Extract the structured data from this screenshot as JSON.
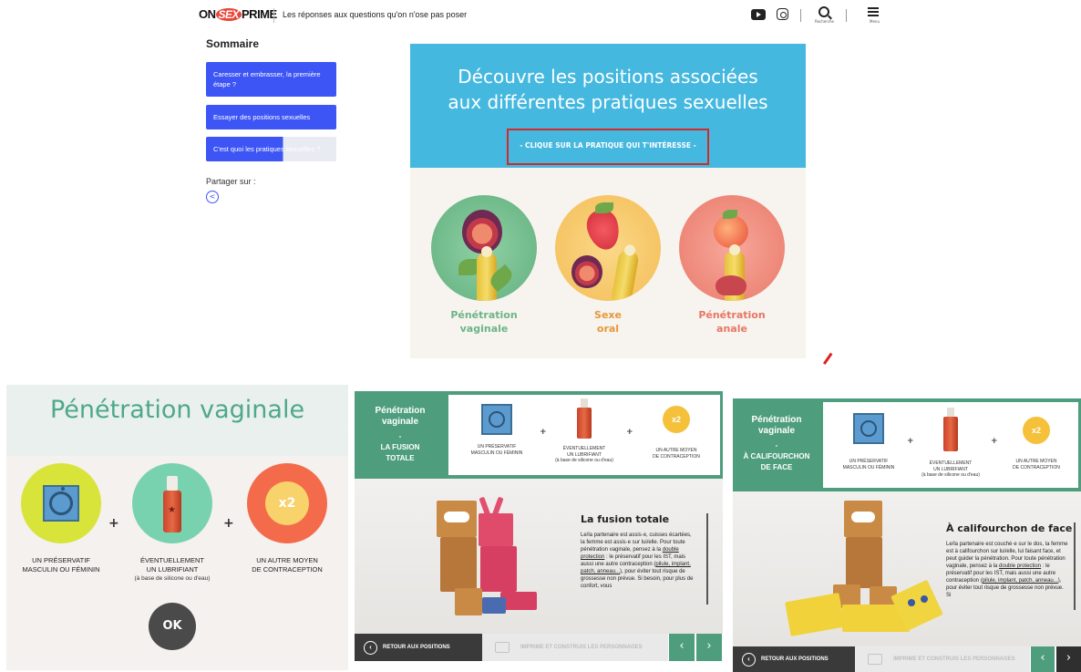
{
  "header": {
    "logo_left": "ON",
    "logo_mid": "SEX",
    "logo_right": "PRIME",
    "tagline": "Les réponses aux questions qu'on n'ose pas poser",
    "search_label": "Recherche",
    "menu_label": "Menu",
    "icons": [
      "youtube-icon",
      "instagram-icon",
      "search-icon",
      "menu-icon"
    ]
  },
  "sidebar": {
    "title": "Sommaire",
    "items": [
      {
        "label": "Caresser et embrasser, la première étape ?"
      },
      {
        "label": "Essayer des positions sexuelles"
      },
      {
        "label": "C'est quoi les pratiques sexuelles ?"
      }
    ],
    "share_label": "Partager sur :"
  },
  "hero": {
    "title_line1": "Découvre les positions associées",
    "title_line2": "aux différentes pratiques sexuelles",
    "cta": "- CLIQUE SUR LA PRATIQUE QUI T'INTÉRESSE -"
  },
  "choices": [
    {
      "line1": "Pénétration",
      "line2": "vaginale",
      "color": "#7cbf8f"
    },
    {
      "line1": "Sexe",
      "line2": "oral",
      "color": "#e8973a"
    },
    {
      "line1": "Pénétration",
      "line2": "anale",
      "color": "#ea7b6c"
    }
  ],
  "panel_protection": {
    "title": "Pénétration vaginale",
    "items": [
      {
        "line1": "UN PRÉSERVATIF",
        "line2": "MASCULIN OU FÉMININ",
        "sub": ""
      },
      {
        "line1": "ÉVENTUELLEMENT",
        "line2": "UN LUBRIFIANT",
        "sub": "(à base de silicone ou d'eau)"
      },
      {
        "line1": "UN AUTRE MOYEN",
        "line2": "DE CONTRACEPTION",
        "sub": ""
      }
    ],
    "x2": "x2",
    "ok": "OK"
  },
  "panel_fusion": {
    "tab_title_1": "Pénétration",
    "tab_title_2": "vaginale",
    "tab_dash": "-",
    "tab_sub_1": "LA FUSION",
    "tab_sub_2": "TOTALE",
    "items": [
      {
        "line1": "UN PRÉSERVATIF",
        "line2": "MASCULIN OU FÉMININ",
        "sub": ""
      },
      {
        "line1": "ÉVENTUELLEMENT",
        "line2": "UN LUBRIFIANT",
        "sub": "(à base de silicone ou d'eau)"
      },
      {
        "line1": "UN AUTRE MOYEN",
        "line2": "DE CONTRACEPTION",
        "sub": ""
      }
    ],
    "x2": "x2",
    "scene_title": "La fusion totale",
    "text_1": "Le/la partenaire est assis·e, cuisses écartées, la femme est assis·e sur lui/elle. Pour toute pénétration vaginale, pensez à la ",
    "link_1": "double protection",
    "text_2": " : le préservatif pour les IST, mais aussi une autre contraception (",
    "link_2": "pilule, implant, patch, anneau...",
    "text_3": "), pour éviter tout risque de grossesse non prévue. Si besoin, pour plus de confort, vous",
    "back": "RETOUR AUX POSITIONS",
    "print": "IMPRIME ET CONSTRUIS LES PERSONNAGES",
    "prev": "‹",
    "next": "›"
  },
  "panel_califourchon": {
    "tab_title_1": "Pénétration",
    "tab_title_2": "vaginale",
    "tab_dash": "-",
    "tab_sub_1": "À CALIFOURCHON",
    "tab_sub_2": "DE FACE",
    "items": [
      {
        "line1": "UN PRÉSERVATIF",
        "line2": "MASCULIN OU FÉMININ",
        "sub": ""
      },
      {
        "line1": "ÉVENTUELLEMENT",
        "line2": "UN LUBRIFIANT",
        "sub": "(à base de silicone ou d'eau)"
      },
      {
        "line1": "UN AUTRE MOYEN",
        "line2": "DE CONTRACEPTION",
        "sub": ""
      }
    ],
    "x2": "x2",
    "scene_title": "À califourchon de face",
    "text_1": "Le/la partenaire est couché·e sur le dos, la femme est à califourchon sur lui/elle, lui faisant face, et peut guider la pénétration. Pour toute pénétration vaginale, pensez à la ",
    "link_1": "double protection",
    "text_2": " : le préservatif pour les IST, mais aussi une autre contraception (",
    "link_2": "pilule, implant, patch, anneau...",
    "text_3": "), pour éviter tout risque de grossesse non prévue. Si",
    "back": "RETOUR AUX POSITIONS",
    "print": "IMPRIME ET CONSTRUIS LES PERSONNAGES",
    "prev": "‹",
    "next": "›"
  },
  "colors": {
    "accent_blue": "#3d55f5",
    "hero_blue": "#45b8df",
    "green": "#4e9e7e",
    "cta_border": "#d12a2a"
  }
}
